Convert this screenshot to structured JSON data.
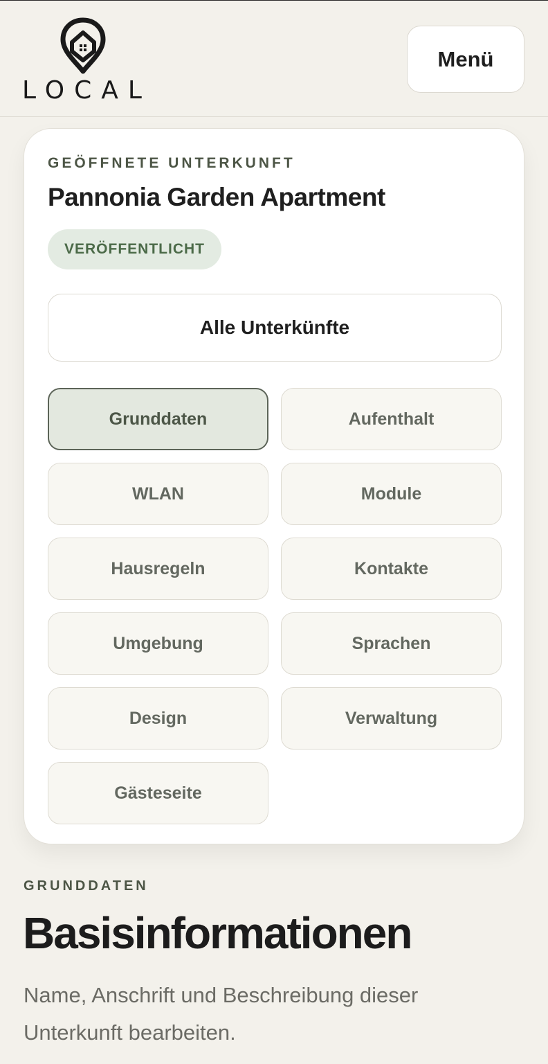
{
  "header": {
    "logo_text": "LOCAL",
    "menu_label": "Menü"
  },
  "property": {
    "eyebrow": "GEÖFFNETE UNTERKUNFT",
    "title": "Pannonia Garden Apartment",
    "status": "VERÖFFENTLICHT",
    "all_button": "Alle Unterkünfte"
  },
  "tabs": [
    {
      "label": "Grunddaten",
      "active": true
    },
    {
      "label": "Aufenthalt",
      "active": false
    },
    {
      "label": "WLAN",
      "active": false
    },
    {
      "label": "Module",
      "active": false
    },
    {
      "label": "Hausregeln",
      "active": false
    },
    {
      "label": "Kontakte",
      "active": false
    },
    {
      "label": "Umgebung",
      "active": false
    },
    {
      "label": "Sprachen",
      "active": false
    },
    {
      "label": "Design",
      "active": false
    },
    {
      "label": "Verwaltung",
      "active": false
    },
    {
      "label": "Gästeseite",
      "active": false
    }
  ],
  "section": {
    "eyebrow": "GRUNDDATEN",
    "title": "Basisinformationen",
    "description": "Name, Anschrift und Beschreibung dieser Unterkunft bearbeiten."
  },
  "icons": {
    "logo": "house-location-pin-icon"
  }
}
